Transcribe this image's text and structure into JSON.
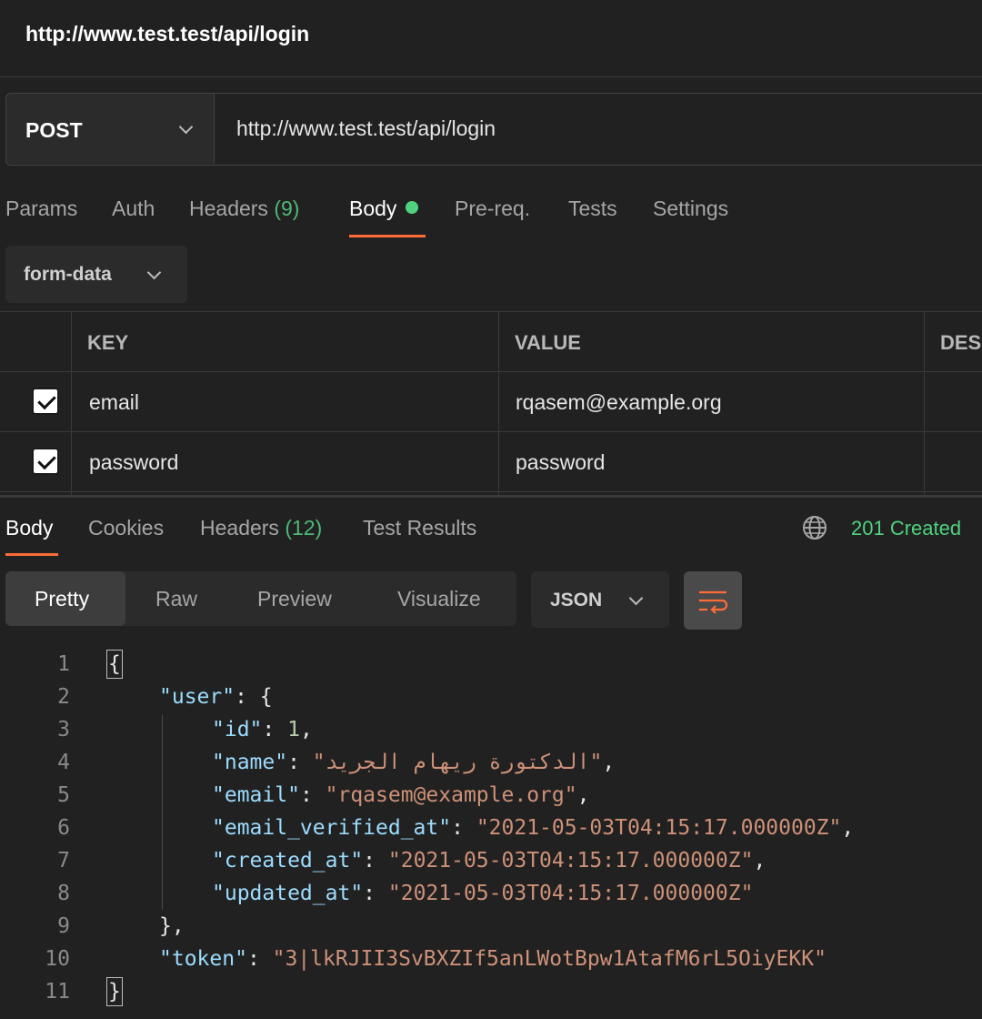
{
  "window": {
    "title": "http://www.test.test/api/login"
  },
  "request": {
    "method": "POST",
    "url": "http://www.test.test/api/login"
  },
  "request_tabs": {
    "params": "Params",
    "auth": "Auth",
    "headers": "Headers",
    "headers_count": "(9)",
    "body": "Body",
    "prereq": "Pre-req.",
    "tests": "Tests",
    "settings": "Settings"
  },
  "body_mode": {
    "label": "form-data"
  },
  "form_table": {
    "columns": [
      "KEY",
      "VALUE",
      "DES"
    ],
    "rows": [
      {
        "key": "email",
        "value": "rqasem@example.org",
        "checked": true
      },
      {
        "key": "password",
        "value": "password",
        "checked": true
      }
    ]
  },
  "response_tabs": {
    "body": "Body",
    "cookies": "Cookies",
    "headers": "Headers",
    "headers_count": "(12)",
    "test_results": "Test Results",
    "status": "201 Created"
  },
  "view_modes": {
    "pretty": "Pretty",
    "raw": "Raw",
    "preview": "Preview",
    "visualize": "Visualize",
    "format": "JSON"
  },
  "code": {
    "line_numbers": [
      "1",
      "2",
      "3",
      "4",
      "5",
      "6",
      "7",
      "8",
      "9",
      "10",
      "11"
    ],
    "open_brace": "{",
    "close_brace": "}",
    "user_key": "\"user\"",
    "user_open": ": {",
    "id_key": "\"id\"",
    "id_value": "1",
    "name_key": "\"name\"",
    "name_value": "\"الدكتورة ريهام الجريد\"",
    "email_key": "\"email\"",
    "email_value": "\"rqasem@example.org\"",
    "email_verified_key": "\"email_verified_at\"",
    "email_verified_value": "\"2021-05-03T04:15:17.000000Z\"",
    "created_key": "\"created_at\"",
    "created_value": "\"2021-05-03T04:15:17.000000Z\"",
    "updated_key": "\"updated_at\"",
    "updated_value": "\"2021-05-03T04:15:17.000000Z\"",
    "user_close": "},",
    "token_key": "\"token\"",
    "token_value": "\"3|lkRJII3SvBXZIf5anLWotBpw1AtafM6rL5OiyEKK\""
  }
}
